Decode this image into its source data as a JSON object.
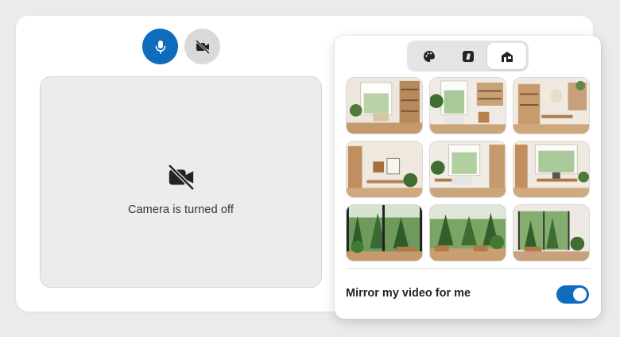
{
  "preview": {
    "message": "Camera is turned off"
  },
  "controls": {
    "mic_state": "on",
    "camera_state": "off"
  },
  "background_panel": {
    "tabs": [
      {
        "icon": "palette-icon",
        "active": false
      },
      {
        "icon": "blur-icon",
        "active": false
      },
      {
        "icon": "room-icon",
        "active": true
      }
    ],
    "backgrounds": [
      "room-1",
      "room-2",
      "room-3",
      "room-4",
      "room-5",
      "room-6",
      "room-7",
      "room-8",
      "room-9"
    ],
    "mirror_label": "Mirror my video for me",
    "mirror_enabled": true
  },
  "colors": {
    "accent": "#0f6cbd",
    "page_background": "#ebebed"
  }
}
